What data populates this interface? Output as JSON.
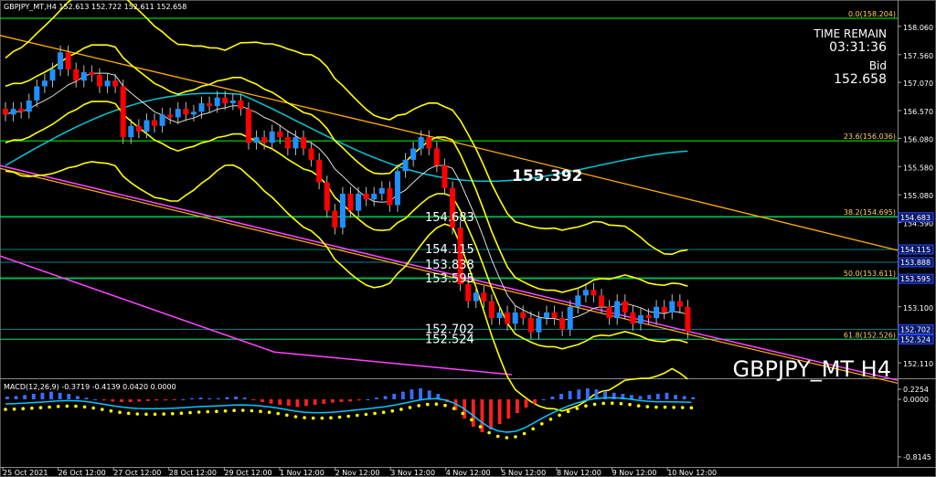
{
  "header": {
    "symbol_line": "GBPJPY_MT,H4  152.613 152.722 152.611 152.658"
  },
  "info_panel": {
    "time_label": "TIME REMAIN",
    "time_value": "03:31:36",
    "bid_label": "Bid",
    "bid_value": "152.658"
  },
  "watermark": "GBPJPY_MT H4",
  "macd": {
    "label": "MACD(12,26,9) -0.3719 -0.4139 0.0420 0.0000",
    "axis_ticks": [
      "0.2254",
      "0.0000",
      "-0.8145"
    ]
  },
  "colors": {
    "bull": "#1e90ff",
    "bear": "#ff0000",
    "bands": "#ffff00",
    "ma_cyan": "#00c8d8",
    "channel": "#ff44ff",
    "trend": "#ffb000",
    "fib": "#00ff00"
  },
  "chart_data": {
    "type": "candlestick",
    "symbol": "GBPJPY_MT",
    "timeframe": "H4",
    "ylim": [
      151.9,
      158.3
    ],
    "y_ticks": [
      "158.060",
      "157.560",
      "157.070",
      "156.570",
      "156.080",
      "155.580",
      "155.080",
      "154.590",
      "154.090",
      "153.600",
      "153.100",
      "152.610",
      "152.110"
    ],
    "x_ticks": [
      "25 Oct 2021",
      "26 Oct 12:00",
      "27 Oct 12:00",
      "28 Oct 12:00",
      "29 Oct 12:00",
      "1 Nov 12:00",
      "2 Nov 12:00",
      "3 Nov 12:00",
      "4 Nov 12:00",
      "5 Nov 12:00",
      "8 Nov 12:00",
      "9 Nov 12:00",
      "10 Nov 12:00"
    ],
    "candles": [
      {
        "o": 156.6,
        "c": 156.5
      },
      {
        "o": 156.5,
        "c": 156.6
      },
      {
        "o": 156.6,
        "c": 156.55
      },
      {
        "o": 156.55,
        "c": 156.75
      },
      {
        "o": 156.75,
        "c": 157.0
      },
      {
        "o": 157.0,
        "c": 157.1
      },
      {
        "o": 157.1,
        "c": 157.3
      },
      {
        "o": 157.3,
        "c": 157.6
      },
      {
        "o": 157.6,
        "c": 157.3
      },
      {
        "o": 157.3,
        "c": 157.1
      },
      {
        "o": 157.1,
        "c": 157.25
      },
      {
        "o": 157.25,
        "c": 157.2
      },
      {
        "o": 157.2,
        "c": 157.0
      },
      {
        "o": 157.0,
        "c": 157.1
      },
      {
        "o": 157.1,
        "c": 157.0
      },
      {
        "o": 157.0,
        "c": 156.1
      },
      {
        "o": 156.1,
        "c": 156.3
      },
      {
        "o": 156.3,
        "c": 156.2
      },
      {
        "o": 156.2,
        "c": 156.4
      },
      {
        "o": 156.4,
        "c": 156.3
      },
      {
        "o": 156.3,
        "c": 156.5
      },
      {
        "o": 156.5,
        "c": 156.45
      },
      {
        "o": 156.45,
        "c": 156.6
      },
      {
        "o": 156.6,
        "c": 156.5
      },
      {
        "o": 156.5,
        "c": 156.55
      },
      {
        "o": 156.55,
        "c": 156.7
      },
      {
        "o": 156.7,
        "c": 156.65
      },
      {
        "o": 156.65,
        "c": 156.8
      },
      {
        "o": 156.8,
        "c": 156.7
      },
      {
        "o": 156.7,
        "c": 156.75
      },
      {
        "o": 156.75,
        "c": 156.6
      },
      {
        "o": 156.6,
        "c": 156.0
      },
      {
        "o": 156.0,
        "c": 156.1
      },
      {
        "o": 156.1,
        "c": 156.0
      },
      {
        "o": 156.0,
        "c": 156.2
      },
      {
        "o": 156.2,
        "c": 156.1
      },
      {
        "o": 156.1,
        "c": 155.9
      },
      {
        "o": 155.9,
        "c": 156.1
      },
      {
        "o": 156.1,
        "c": 155.9
      },
      {
        "o": 155.9,
        "c": 155.7
      },
      {
        "o": 155.7,
        "c": 155.3
      },
      {
        "o": 155.3,
        "c": 154.8
      },
      {
        "o": 154.8,
        "c": 154.5
      },
      {
        "o": 154.5,
        "c": 155.1
      },
      {
        "o": 155.1,
        "c": 154.8
      },
      {
        "o": 154.8,
        "c": 155.1
      },
      {
        "o": 155.1,
        "c": 155.0
      },
      {
        "o": 155.0,
        "c": 155.1
      },
      {
        "o": 155.1,
        "c": 155.2
      },
      {
        "o": 155.2,
        "c": 154.9
      },
      {
        "o": 154.9,
        "c": 155.5
      },
      {
        "o": 155.5,
        "c": 155.7
      },
      {
        "o": 155.7,
        "c": 155.9
      },
      {
        "o": 155.9,
        "c": 156.1
      },
      {
        "o": 156.1,
        "c": 155.9
      },
      {
        "o": 155.9,
        "c": 155.6
      },
      {
        "o": 155.6,
        "c": 155.2
      },
      {
        "o": 155.2,
        "c": 154.5
      },
      {
        "o": 154.5,
        "c": 153.5
      },
      {
        "o": 153.5,
        "c": 153.2
      },
      {
        "o": 153.2,
        "c": 153.35
      },
      {
        "o": 153.35,
        "c": 153.2
      },
      {
        "o": 153.2,
        "c": 152.9
      },
      {
        "o": 152.9,
        "c": 153.0
      },
      {
        "o": 153.0,
        "c": 152.8
      },
      {
        "o": 152.8,
        "c": 153.0
      },
      {
        "o": 153.0,
        "c": 152.9
      },
      {
        "o": 152.9,
        "c": 152.65
      },
      {
        "o": 152.65,
        "c": 152.9
      },
      {
        "o": 152.9,
        "c": 153.0
      },
      {
        "o": 153.0,
        "c": 152.9
      },
      {
        "o": 152.9,
        "c": 152.7
      },
      {
        "o": 152.7,
        "c": 153.1
      },
      {
        "o": 153.1,
        "c": 153.3
      },
      {
        "o": 153.3,
        "c": 153.4
      },
      {
        "o": 153.4,
        "c": 153.3
      },
      {
        "o": 153.3,
        "c": 153.1
      },
      {
        "o": 153.1,
        "c": 152.9
      },
      {
        "o": 152.9,
        "c": 153.2
      },
      {
        "o": 153.2,
        "c": 153.0
      },
      {
        "o": 153.0,
        "c": 152.8
      },
      {
        "o": 152.8,
        "c": 152.95
      },
      {
        "o": 152.95,
        "c": 152.9
      },
      {
        "o": 152.9,
        "c": 153.1
      },
      {
        "o": 153.1,
        "c": 153.0
      },
      {
        "o": 153.0,
        "c": 153.2
      },
      {
        "o": 153.2,
        "c": 153.1
      },
      {
        "o": 153.1,
        "c": 152.66
      }
    ],
    "price_labels": [
      {
        "text": "155.392",
        "value": 155.392,
        "big": true
      },
      {
        "text": "154.683",
        "value": 154.683
      },
      {
        "text": "154.115",
        "value": 154.115
      },
      {
        "text": "153.838",
        "value": 153.838
      },
      {
        "text": "153.595",
        "value": 153.595
      },
      {
        "text": "152.702",
        "value": 152.702
      },
      {
        "text": "152.524",
        "value": 152.524
      }
    ],
    "fib_levels": [
      {
        "text": "0.0(158.204)",
        "value": 158.204
      },
      {
        "text": "23.6(156.036)",
        "value": 156.036
      },
      {
        "text": "38.2(154.695)",
        "value": 154.695
      },
      {
        "text": "50.0(153.611)",
        "value": 153.611
      },
      {
        "text": "61.8(152.526)",
        "value": 152.526
      }
    ],
    "horizontal_lines": [
      {
        "text": "154.683",
        "value": 154.683,
        "color": "#00c8ff"
      },
      {
        "text": "154.115",
        "value": 154.115,
        "color": "#00c8ff"
      },
      {
        "text": "153.888",
        "value": 153.888,
        "color": "#00c8ff"
      },
      {
        "text": "153.595",
        "value": 153.595,
        "color": "#00c8ff"
      },
      {
        "text": "152.702",
        "value": 152.702,
        "color": "#00c8ff"
      },
      {
        "text": "152.524",
        "value": 152.524,
        "color": "#00c8ff"
      }
    ],
    "macd_histogram": [
      0.05,
      0.06,
      0.08,
      0.1,
      0.12,
      0.14,
      0.12,
      0.1,
      0.06,
      0.03,
      0.0,
      -0.02,
      -0.04,
      -0.05,
      -0.05,
      -0.04,
      -0.03,
      -0.02,
      -0.02,
      -0.01,
      0.0,
      0.02,
      0.03,
      0.02,
      0.02,
      0.04,
      0.05,
      0.03,
      -0.01,
      -0.05,
      -0.08,
      -0.1,
      -0.12,
      -0.14,
      -0.12,
      -0.1,
      -0.08,
      -0.06,
      -0.05,
      -0.04,
      -0.02,
      0.0,
      0.03,
      0.06,
      0.1,
      0.14,
      0.18,
      0.2,
      0.16,
      0.1,
      -0.05,
      -0.2,
      -0.35,
      -0.5,
      -0.6,
      -0.55,
      -0.45,
      -0.35,
      -0.25,
      -0.15,
      -0.08,
      0.0,
      0.05,
      0.1,
      0.15,
      0.18,
      0.2,
      0.18,
      0.15,
      0.12,
      0.1,
      0.08,
      0.06,
      0.08,
      0.1,
      0.12,
      0.08,
      0.06,
      0.04
    ]
  }
}
